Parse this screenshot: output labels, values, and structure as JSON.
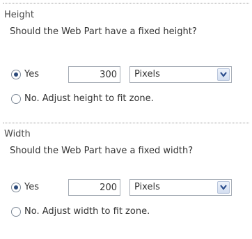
{
  "height": {
    "title": "Height",
    "question": "Should the Web Part have a fixed height?",
    "yes_label": "Yes",
    "value": "300",
    "unit": "Pixels",
    "no_label": "No. Adjust height to fit zone.",
    "selected": "yes"
  },
  "width": {
    "title": "Width",
    "question": "Should the Web Part have a fixed width?",
    "yes_label": "Yes",
    "value": "200",
    "unit": "Pixels",
    "no_label": "No. Adjust width to fit zone.",
    "selected": "yes"
  },
  "icons": {
    "dropdown": "chevron-down-icon"
  }
}
